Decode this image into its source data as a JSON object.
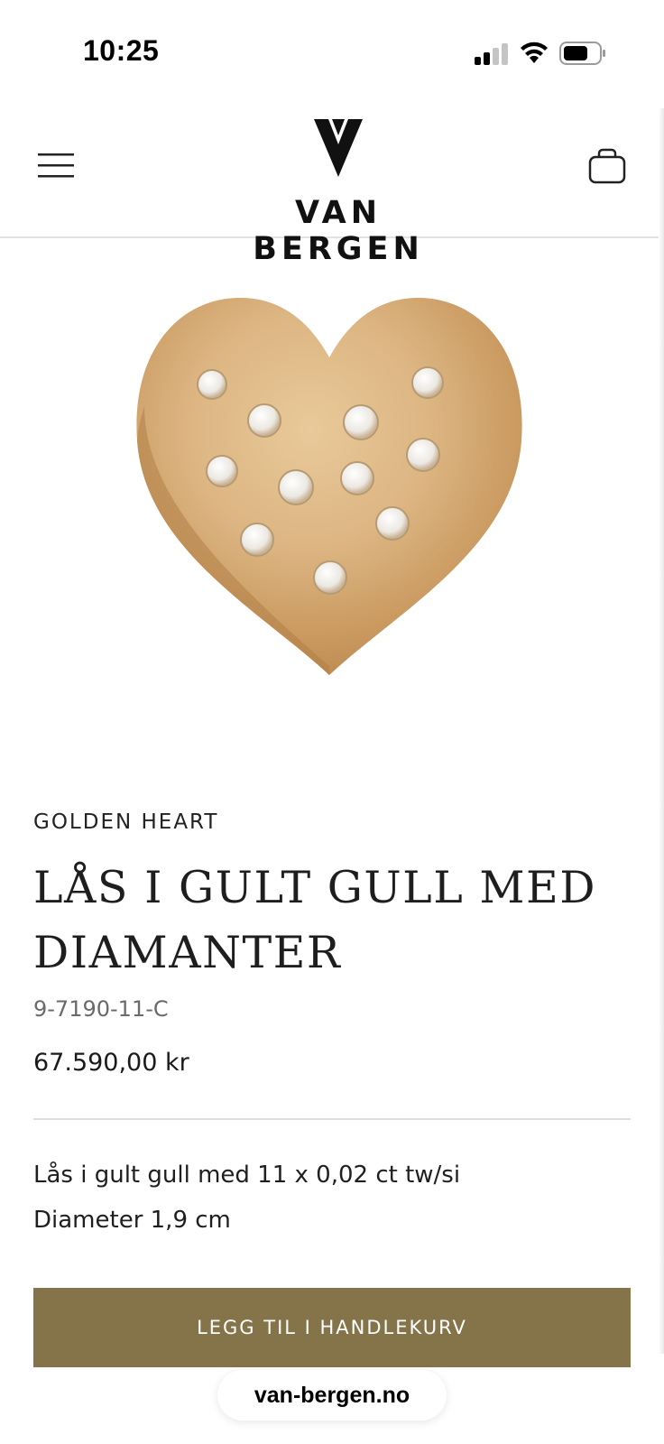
{
  "status_bar": {
    "time": "10:25",
    "signal_icon": "cellular-signal-icon",
    "wifi_icon": "wifi-icon",
    "battery_icon": "battery-icon"
  },
  "header": {
    "menu_icon": "hamburger-menu-icon",
    "brand_name": "VAN BERGEN",
    "brand_mark": "v-logo-icon",
    "cart_icon": "shopping-bag-icon"
  },
  "product": {
    "image": "golden-heart-diamond-pendant",
    "collection": "GOLDEN HEART",
    "title": "LÅS I GULT GULL MED DIAMANTER",
    "sku": "9-7190-11-C",
    "price": "67.590,00 kr",
    "description": [
      "Lås i gult gull med 11 x 0,02 ct tw/si",
      "Diameter 1,9 cm"
    ],
    "add_to_cart_label": "LEGG TIL I HANDLEKURV"
  },
  "browser": {
    "url": "van-bergen.no"
  },
  "colors": {
    "accent": "#85734a",
    "divider": "#dedede",
    "sku_text": "#6a6a6a"
  }
}
